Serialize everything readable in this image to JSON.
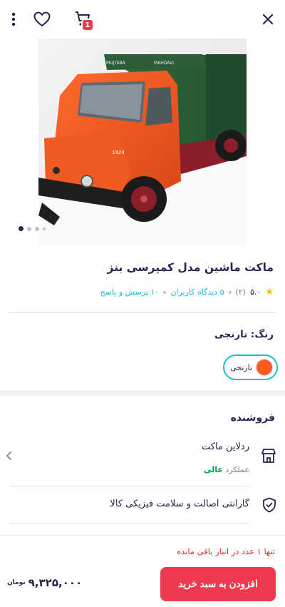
{
  "header": {
    "cart_count": "1"
  },
  "product": {
    "title": "ماکت ماشین مدل کمپرسی بنز",
    "rating": "۵.۰",
    "rating_count": "(۲)",
    "reviews_link": "۵ دیدگاه کاربران",
    "qa_link": "۱۰ پرسش و پاسخ",
    "image_text": {
      "cab_left": "MUJTABA",
      "cab_right": "MAHDAVI",
      "door_badge": "1924"
    },
    "gallery": {
      "total": 4,
      "active": 1
    }
  },
  "color": {
    "label": "رنگ: نارنجی",
    "options": [
      {
        "name": "نارنجی",
        "hex": "#ff5a1f",
        "selected": true
      }
    ]
  },
  "seller": {
    "section_title": "فروشنده",
    "name": "ردلاین ماکت",
    "performance_label": "عملکرد",
    "performance_value": "عالی"
  },
  "warranty": {
    "label": "گارانتی اصالت و سلامت فیزیکی کالا"
  },
  "purchase": {
    "stock_note": "تنها ۱ عدد در انبار باقی مانده",
    "add_button": "افزودن به سبد خرید",
    "price": "۹,۳۲۵,۰۰۰",
    "currency": "تومان"
  },
  "colors": {
    "accent": "#ef394e",
    "link": "#19bfd3",
    "success": "#00a049"
  }
}
